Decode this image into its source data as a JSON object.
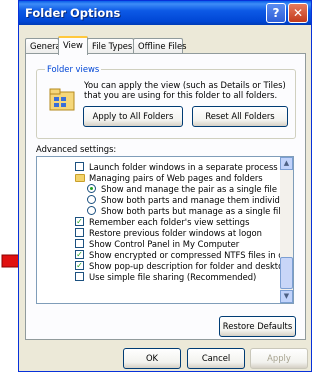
{
  "window": {
    "title": "Folder Options",
    "help": "?",
    "close": "✕"
  },
  "tabs": [
    "General",
    "View",
    "File Types",
    "Offline Files"
  ],
  "folder_views": {
    "label": "Folder views",
    "description": "You can apply the view (such as Details or Tiles) that you are using for this folder to all folders.",
    "apply_button": "Apply to All Folders",
    "reset_button": "Reset All Folders"
  },
  "advanced": {
    "label": "Advanced settings:",
    "items": [
      {
        "type": "checkbox",
        "checked": false,
        "text": "Launch folder windows in a separate process"
      },
      {
        "type": "folder",
        "text": "Managing pairs of Web pages and folders"
      },
      {
        "type": "radio",
        "checked": true,
        "text": "Show and manage the pair as a single file"
      },
      {
        "type": "radio",
        "checked": false,
        "text": "Show both parts and manage them individually"
      },
      {
        "type": "radio",
        "checked": false,
        "text": "Show both parts but manage as a single file"
      },
      {
        "type": "checkbox",
        "checked": true,
        "text": "Remember each folder's view settings"
      },
      {
        "type": "checkbox",
        "checked": false,
        "text": "Restore previous folder windows at logon"
      },
      {
        "type": "checkbox",
        "checked": false,
        "text": "Show Control Panel in My Computer"
      },
      {
        "type": "checkbox",
        "checked": true,
        "text": "Show encrypted or compressed NTFS files in color"
      },
      {
        "type": "checkbox",
        "checked": true,
        "text": "Show pop-up description for folder and desktop items"
      },
      {
        "type": "checkbox",
        "checked": false,
        "text": "Use simple file sharing (Recommended)"
      }
    ]
  },
  "restore_defaults": "Restore Defaults",
  "footer": {
    "ok": "OK",
    "cancel": "Cancel",
    "apply": "Apply"
  },
  "colors": {
    "title_bar": "#0054e3",
    "annotation_arrow": "#e01010",
    "check": "#21a121"
  }
}
